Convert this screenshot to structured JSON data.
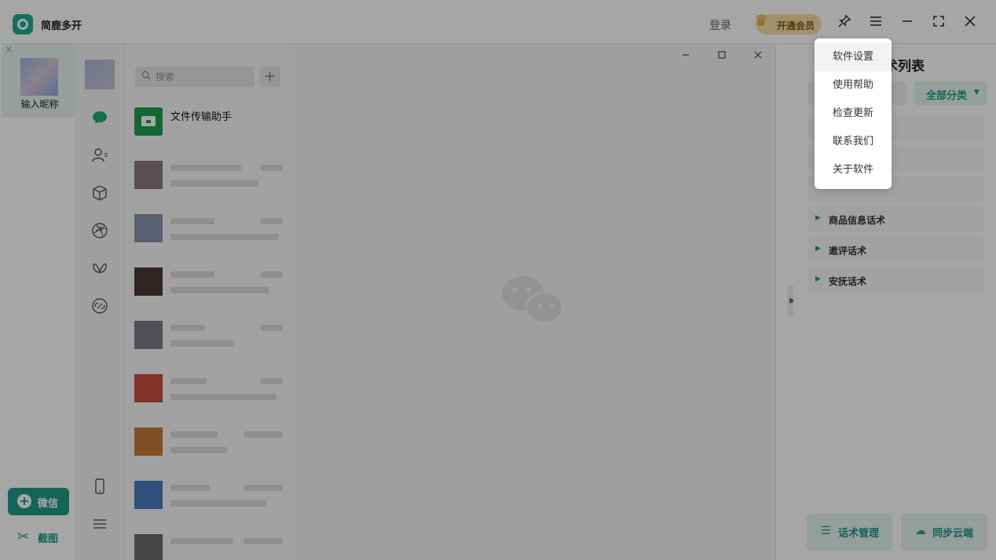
{
  "titlebar": {
    "app_title": "简鹿多开",
    "login": "登录",
    "vip_label": "开通会员"
  },
  "account_rail": {
    "account_name": "输入昵称",
    "add_wechat": "微信",
    "screenshot": "截图"
  },
  "wechat": {
    "search_placeholder": "搜索",
    "add_icon": "+",
    "file_transfer": "文件传输助手"
  },
  "script_panel": {
    "title_visible": "术列表",
    "category": "全部分类",
    "groups": [
      {
        "label": "商品信息话术"
      },
      {
        "label": "邀评话术"
      },
      {
        "label": "安抚话术"
      }
    ],
    "manage_button": "话术管理",
    "sync_button": "同步云端"
  },
  "menu": {
    "items": [
      {
        "label": "软件设置"
      },
      {
        "label": "使用帮助"
      },
      {
        "label": "检查更新"
      },
      {
        "label": "联系我们"
      },
      {
        "label": "关于软件"
      }
    ]
  },
  "colors": {
    "brand": "#1f9a86",
    "wechat_green": "#1fae6a",
    "overlay": "rgba(0,0,0,0.35)"
  },
  "icons": [
    "pin-icon",
    "menu-icon",
    "minimize-icon",
    "maximize-icon",
    "close-icon",
    "chat-icon",
    "contacts-icon",
    "cube-icon",
    "shutter-icon",
    "butterfly-icon",
    "link-icon",
    "phone-icon",
    "more-icon",
    "search-icon",
    "scissors-icon",
    "list-icon",
    "cloud-upload-icon",
    "crown-icon",
    "wechat-logo-icon"
  ]
}
